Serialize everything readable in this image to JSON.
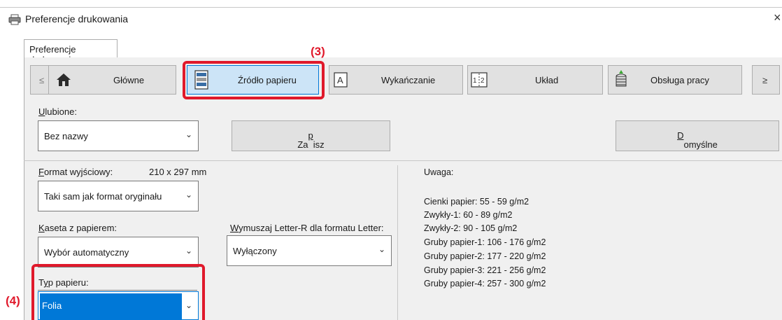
{
  "window": {
    "title": "Preferencje drukowania",
    "close": "×"
  },
  "tabs": [
    {
      "label": "Preferencje drukowania"
    }
  ],
  "nav": {
    "prev": "≤",
    "next": "≥",
    "items": [
      {
        "label": "Główne",
        "icon": "home-icon"
      },
      {
        "label": "Źródło papieru",
        "icon": "paper-source-icon",
        "selected": true
      },
      {
        "label": "Wykańczanie",
        "icon": "finishing-icon"
      },
      {
        "label": "Układ",
        "icon": "layout-icon"
      },
      {
        "label": "Obsługa pracy",
        "icon": "job-handling-icon"
      }
    ]
  },
  "favorites": {
    "label_prefix": "U",
    "label_rest": "lubione:",
    "value": "Bez nazwy",
    "save_prefix": "Za",
    "save_u": "p",
    "save_rest": "isz",
    "default_u": "D",
    "default_rest": "omyślne"
  },
  "output_format": {
    "label_u": "F",
    "label_rest": "ormat wyjściowy:",
    "size": "210 x 297 mm",
    "value": "Taki sam jak format oryginału"
  },
  "tray": {
    "label_u": "K",
    "label_rest": "aseta z papierem:",
    "value": "Wybór automatyczny"
  },
  "letter_r": {
    "label_u": "W",
    "label_rest": "ymuszaj Letter-R dla formatu Letter:",
    "value": "Wyłączony"
  },
  "paper_type": {
    "label_pre": "T",
    "label_u": "y",
    "label_rest": "p papieru:",
    "value": "Folia"
  },
  "notes": {
    "heading": "Uwaga:",
    "lines": [
      "Cienki papier: 55 - 59 g/m2",
      "Zwykły-1: 60 - 89 g/m2",
      "Zwykły-2: 90 - 105 g/m2",
      "Gruby papier-1: 106 - 176 g/m2",
      "Gruby papier-2: 177 - 220 g/m2",
      "Gruby papier-3: 221 - 256 g/m2",
      "Gruby papier-4: 257 - 300 g/m2"
    ]
  },
  "callouts": {
    "step3": "(3)",
    "step4": "(4)"
  },
  "colors": {
    "highlight": "#e0192b",
    "selection": "#0078d7",
    "selected_tab": "#cce4f7"
  }
}
